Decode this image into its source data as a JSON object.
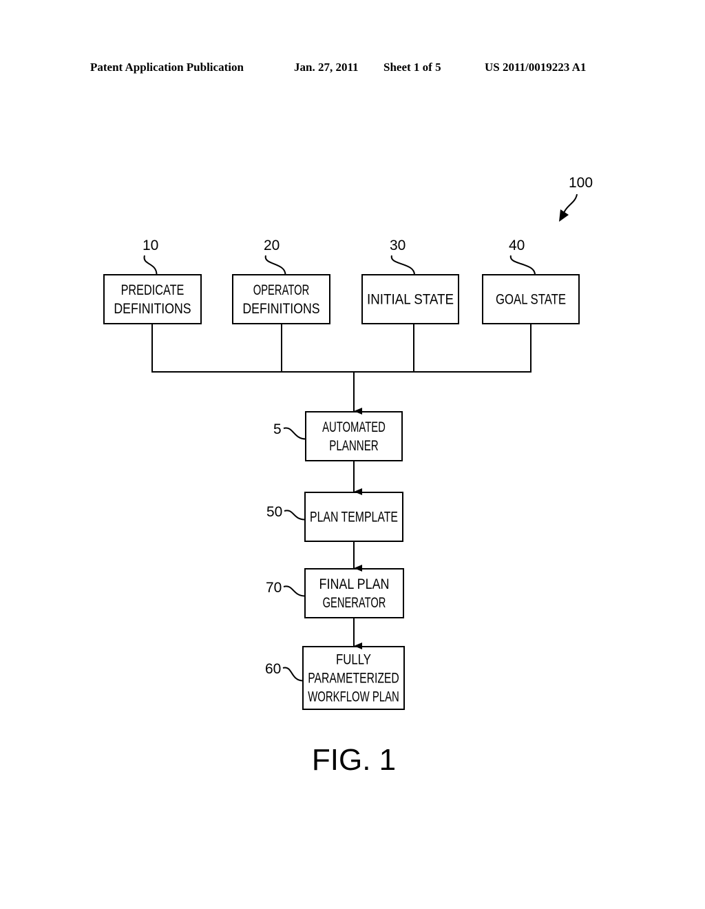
{
  "header": {
    "publication": "Patent Application Publication",
    "date": "Jan. 27, 2011",
    "sheet": "Sheet 1 of 5",
    "number": "US 2011/0019223 A1"
  },
  "figure": {
    "label": "FIG. 1",
    "reference": "100"
  },
  "blocks": {
    "predicate": {
      "ref": "10",
      "lines": [
        "PREDICATE",
        "DEFINITIONS"
      ]
    },
    "operator": {
      "ref": "20",
      "lines": [
        "OPERATOR",
        "DEFINITIONS"
      ]
    },
    "initial": {
      "ref": "30",
      "lines": [
        "INITIAL STATE"
      ]
    },
    "goal": {
      "ref": "40",
      "lines": [
        "GOAL STATE"
      ]
    },
    "planner": {
      "ref": "5",
      "lines": [
        "AUTOMATED",
        "PLANNER"
      ]
    },
    "template": {
      "ref": "50",
      "lines": [
        "PLAN TEMPLATE"
      ]
    },
    "generator": {
      "ref": "70",
      "lines": [
        "FINAL PLAN",
        "GENERATOR"
      ]
    },
    "workflow": {
      "ref": "60",
      "lines": [
        "FULLY",
        "PARAMETERIZED",
        "WORKFLOW PLAN"
      ]
    }
  },
  "connections": [
    {
      "from": [
        "predicate",
        "operator",
        "initial",
        "goal"
      ],
      "to": "planner"
    },
    {
      "from": [
        "planner"
      ],
      "to": "template"
    },
    {
      "from": [
        "template"
      ],
      "to": "generator"
    },
    {
      "from": [
        "generator"
      ],
      "to": "workflow"
    }
  ]
}
